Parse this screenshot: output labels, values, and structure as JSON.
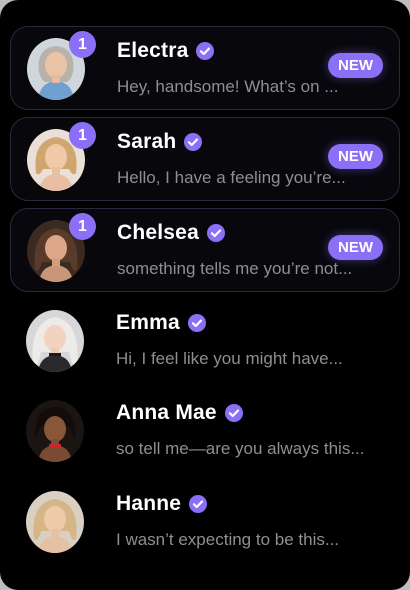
{
  "theme": {
    "accent": "#8B6FF6",
    "background": "#000000",
    "preview_text": "#8E8E93"
  },
  "icons": {
    "verified": "verified-check-badge-icon"
  },
  "chats": [
    {
      "name": "Electra",
      "preview": "Hey, handsome! What’s on ...",
      "unread_count": "1",
      "badge": "NEW"
    },
    {
      "name": "Sarah",
      "preview": "Hello, I have a feeling you’re...",
      "unread_count": "1",
      "badge": "NEW"
    },
    {
      "name": "Chelsea",
      "preview": "something tells me you’re not...",
      "unread_count": "1",
      "badge": "NEW"
    },
    {
      "name": "Emma",
      "preview": "Hi, I feel like you might have..."
    },
    {
      "name": "Anna Mae",
      "preview": "so tell me—are you always this..."
    },
    {
      "name": "Hanne",
      "preview": "I wasn’t expecting to be this..."
    }
  ]
}
